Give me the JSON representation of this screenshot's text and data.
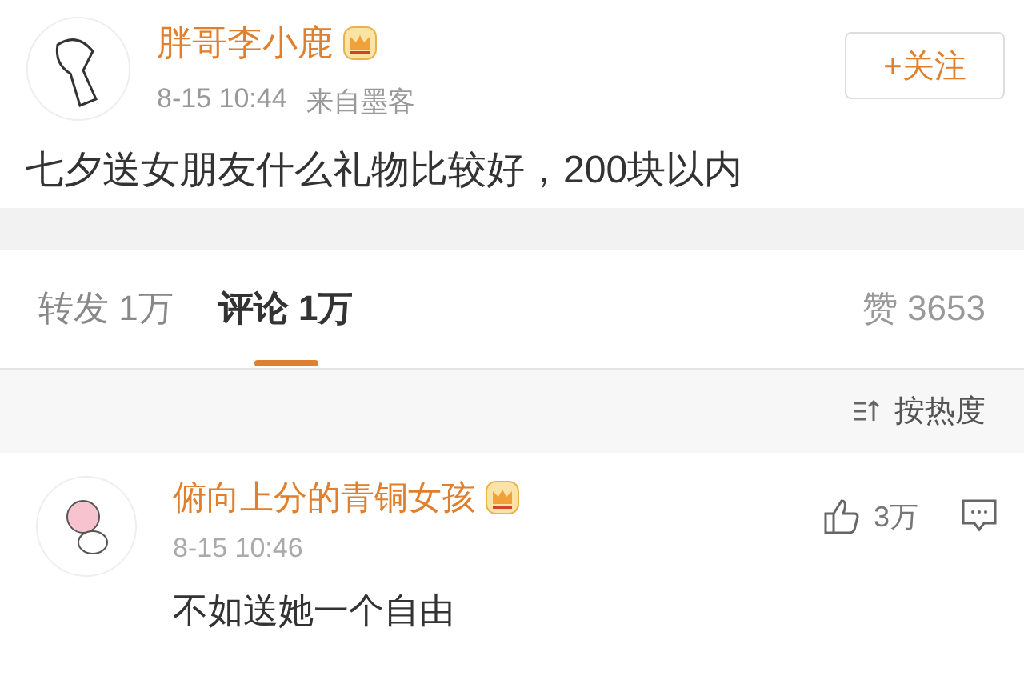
{
  "post": {
    "author": "胖哥李小鹿",
    "vip": true,
    "follow_button": "+关注",
    "time": "8-15 10:44",
    "source": "来自墨客",
    "text": "七夕送女朋友什么礼物比较好，200块以内"
  },
  "tabs": [
    {
      "label": "转发 1万",
      "selected": false
    },
    {
      "label": "评论 1万",
      "selected": true
    }
  ],
  "likes": "赞 3653",
  "sort": "按热度",
  "comments": [
    {
      "author": "俯向上分的青铜女孩",
      "vip": true,
      "time": "8-15 10:46",
      "likes": "3万",
      "text": "不如送她一个自由"
    }
  ]
}
